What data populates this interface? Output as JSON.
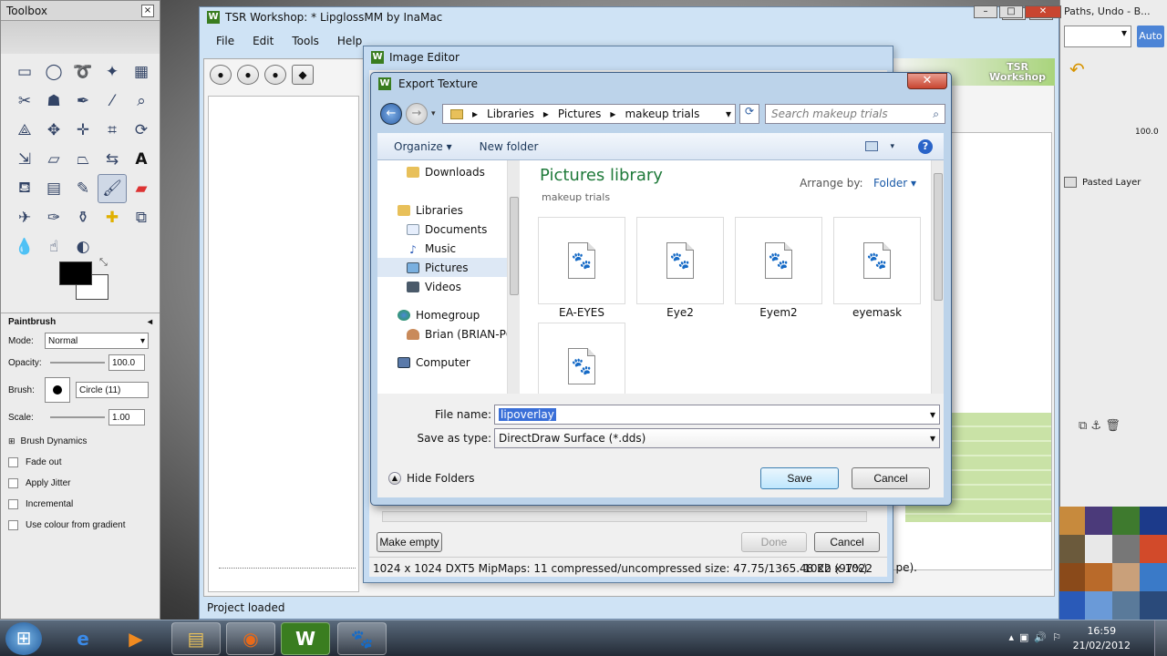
{
  "toolbox": {
    "title": "Toolbox",
    "close": "×",
    "tool_options": {
      "title": "Paintbrush",
      "mode_label": "Mode:",
      "mode_value": "Normal",
      "opacity_label": "Opacity:",
      "opacity_value": "100.0",
      "brush_label": "Brush:",
      "brush_value": "Circle (11)",
      "scale_label": "Scale:",
      "scale_value": "1.00",
      "brush_dynamics": "Brush Dynamics",
      "fade_out": "Fade out",
      "apply_jitter": "Apply Jitter",
      "incremental": "Incremental",
      "use_colour": "Use colour from gradient"
    }
  },
  "tsr": {
    "title": "TSR Workshop: * LipglossMM by InaMac",
    "menu": [
      "File",
      "Edit",
      "Tools",
      "Help"
    ],
    "status": "Project loaded",
    "right_fragment": "pe).",
    "logo_line1": "TSR",
    "logo_line2": "Workshop"
  },
  "gimp_right": {
    "title": "Paths, Undo - B...",
    "auto": "Auto",
    "opacity": "100.0",
    "layer": "Pasted Layer"
  },
  "image_editor": {
    "title": "Image Editor",
    "make_empty": "Make empty",
    "done": "Done",
    "cancel": "Cancel",
    "info": "1024 x 1024 DXT5 MipMaps: 11 compressed/uncompressed size: 47.75/1365.48 Kb (97%)",
    "dims": "1022 x 1022"
  },
  "export": {
    "title": "Export Texture",
    "breadcrumbs": [
      "Libraries",
      "Pictures",
      "makeup trials"
    ],
    "search_placeholder": "Search makeup trials",
    "organize": "Organize",
    "new_folder": "New folder",
    "nav": {
      "downloads": "Downloads",
      "libraries": "Libraries",
      "documents": "Documents",
      "music": "Music",
      "pictures": "Pictures",
      "videos": "Videos",
      "homegroup": "Homegroup",
      "brian": "Brian (BRIAN-PC)",
      "computer": "Computer"
    },
    "library_title": "Pictures library",
    "library_sub": "makeup trials",
    "arrange_label": "Arrange by:",
    "arrange_value": "Folder",
    "files": [
      "EA-EYES",
      "Eye2",
      "Eyem2",
      "eyemask",
      ""
    ],
    "file_name_label": "File name:",
    "file_name_value": "lipoverlay",
    "save_type_label": "Save as type:",
    "save_type_value": "DirectDraw Surface (*.dds)",
    "hide_folders": "Hide Folders",
    "save": "Save",
    "cancel": "Cancel"
  },
  "taskbar": {
    "time": "16:59",
    "date": "21/02/2012"
  }
}
